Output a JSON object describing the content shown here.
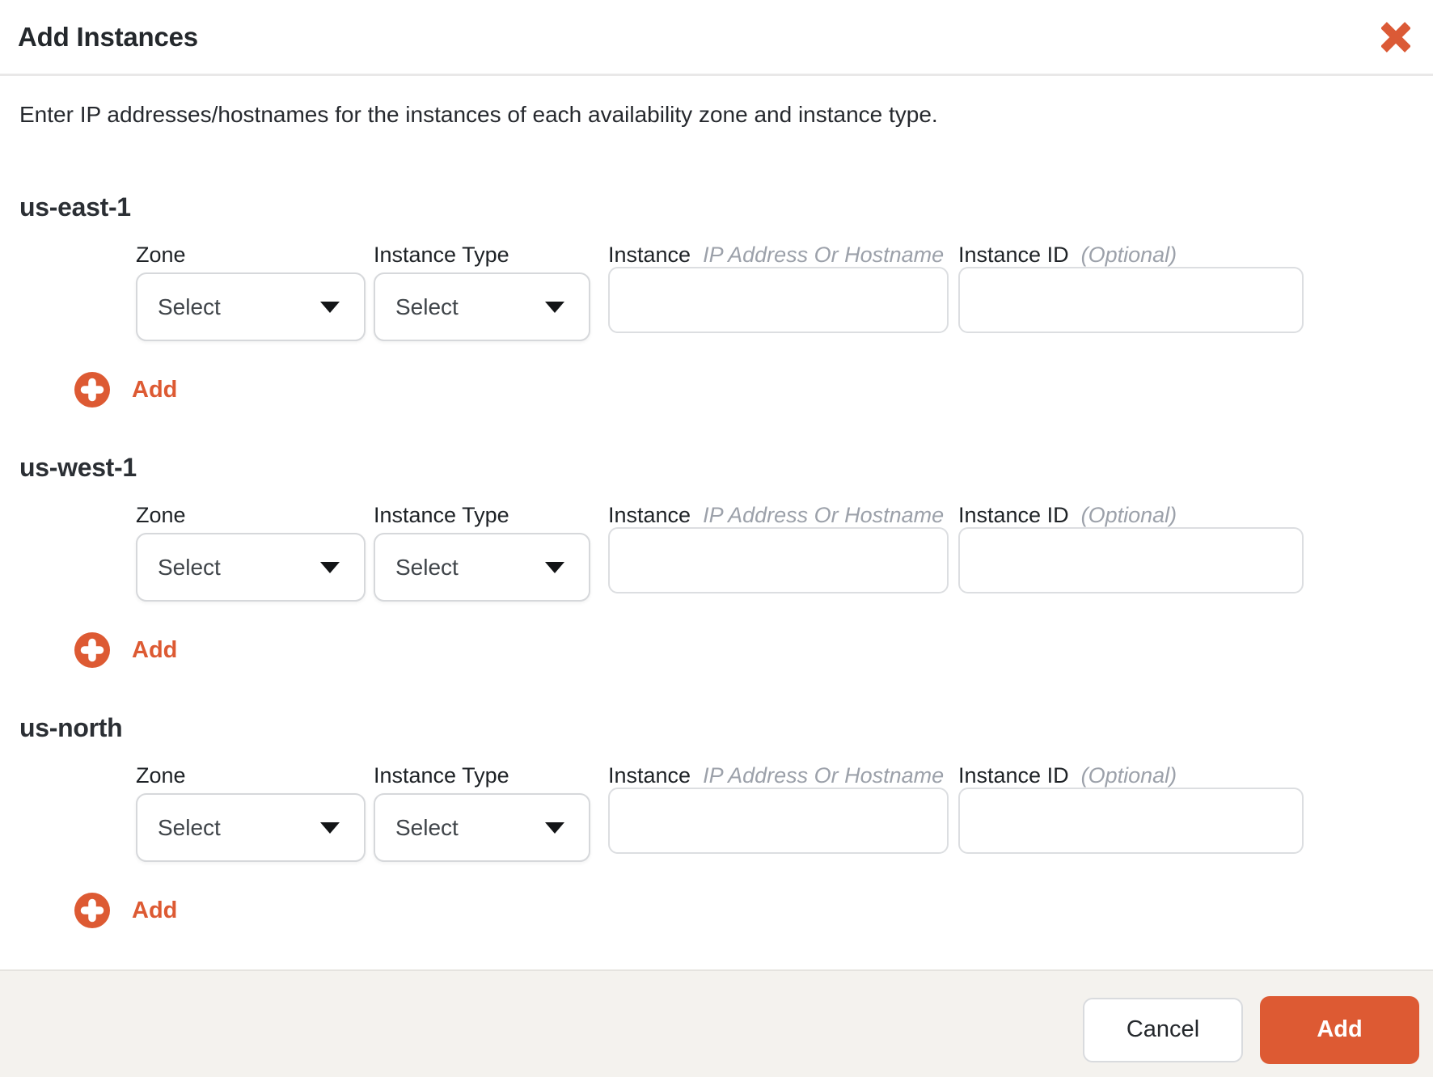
{
  "header": {
    "title": "Add Instances",
    "close_icon": "x-icon"
  },
  "description": "Enter IP addresses/hostnames for the instances of each availability zone and instance type.",
  "sections": [
    {
      "name": "us-east-1"
    },
    {
      "name": "us-west-1"
    },
    {
      "name": "us-north"
    }
  ],
  "fields": {
    "zone_label": "Zone",
    "instance_type_label": "Instance Type",
    "instance_label": "Instance",
    "instance_hint": "IP Address Or Hostname",
    "instance_id_label": "Instance ID",
    "instance_id_hint": "(Optional)",
    "select_placeholder": "Select",
    "zone_selected_value": "Select",
    "instance_type_selected_value": "Select",
    "instance_value": "",
    "instance_id_value": ""
  },
  "add_link_label": "Add",
  "footer": {
    "cancel_label": "Cancel",
    "add_label": "Add"
  },
  "icons": {
    "close": "x-icon",
    "add_row": "plus-circle-icon",
    "select_caret": "chevron-down-icon"
  },
  "colors": {
    "accent_orange": "#DD5A33",
    "footer_background": "#F4F2EE",
    "header_divider": "#E9E8E8",
    "hint_text": "#9CA1AA",
    "primary_text": "#26292E",
    "control_border": "#D9DBDE"
  }
}
